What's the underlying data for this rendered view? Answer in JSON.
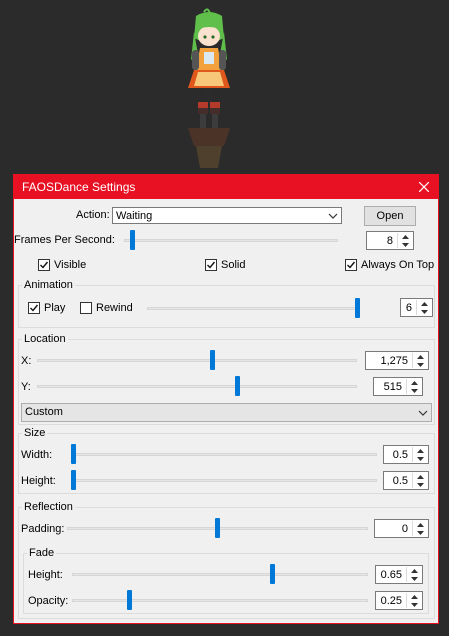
{
  "window": {
    "title": "FAOSDance Settings"
  },
  "controls": {
    "action_label": "Action:",
    "action_value": "Waiting",
    "open_label": "Open",
    "fps_label": "Frames Per Second:",
    "fps_value": "8",
    "fps_level": 0.03,
    "visible_label": "Visible",
    "visible_checked": true,
    "solid_label": "Solid",
    "solid_checked": true,
    "always_on_top_label": "Always On Top",
    "always_on_top_checked": true
  },
  "animation": {
    "title": "Animation",
    "play_label": "Play",
    "play_checked": true,
    "rewind_label": "Rewind",
    "rewind_checked": false,
    "frame_value": "6",
    "frame_level": 1.0
  },
  "location": {
    "title": "Location",
    "x_label": "X:",
    "x_value": "1,275",
    "x_level": 0.55,
    "y_label": "Y:",
    "y_value": "515",
    "y_level": 0.63,
    "preset_value": "Custom"
  },
  "size": {
    "title": "Size",
    "width_label": "Width:",
    "width_value": "0.5",
    "width_level": 0.0,
    "height_label": "Height:",
    "height_value": "0.5",
    "height_level": 0.0
  },
  "reflection": {
    "title": "Reflection",
    "padding_label": "Padding:",
    "padding_value": "0",
    "padding_level": 0.5,
    "fade": {
      "title": "Fade",
      "height_label": "Height:",
      "height_value": "0.65",
      "height_level": 0.68,
      "opacity_label": "Opacity:",
      "opacity_value": "0.25",
      "opacity_level": 0.19
    }
  },
  "colors": {
    "accent": "#0078d7",
    "titlebar": "#e81123",
    "desktop": "#2b2b2b"
  },
  "icons": {
    "close": "close-icon",
    "dropdown": "chevron-down-icon",
    "check": "checkmark-icon"
  }
}
